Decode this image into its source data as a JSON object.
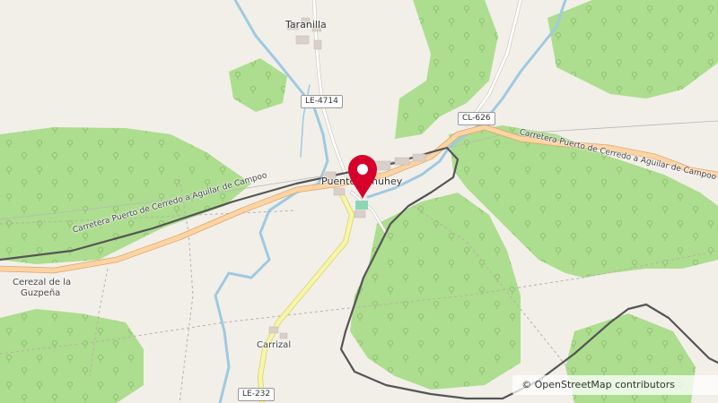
{
  "map": {
    "colors": {
      "background": "#f2efe9",
      "forest": "#addd8e",
      "water": "#9ecae1",
      "road_primary": "#fdd3a3",
      "road_secondary": "#f6f6a8",
      "railway": "#555555",
      "marker": "#d6002b"
    },
    "places": {
      "taranilla": "Taranilla",
      "puente_almuhey": "Puente Almuhey",
      "cerezal_line1": "Cerezal de la",
      "cerezal_line2": "Guzpeña",
      "carrizal": "Carrizal"
    },
    "roads": {
      "carretera_west": "Carretera Puerto de Cerredo a Aguilar de Campoo",
      "carretera_east": "Carretera Puerto de Cerredo a Aguilar de Campoo"
    },
    "shields": {
      "le4714": "LE-4714",
      "cl626": "CL-626",
      "le232": "LE-232"
    },
    "marker_icon": "map-pin-icon",
    "attribution": "© OpenStreetMap contributors"
  }
}
